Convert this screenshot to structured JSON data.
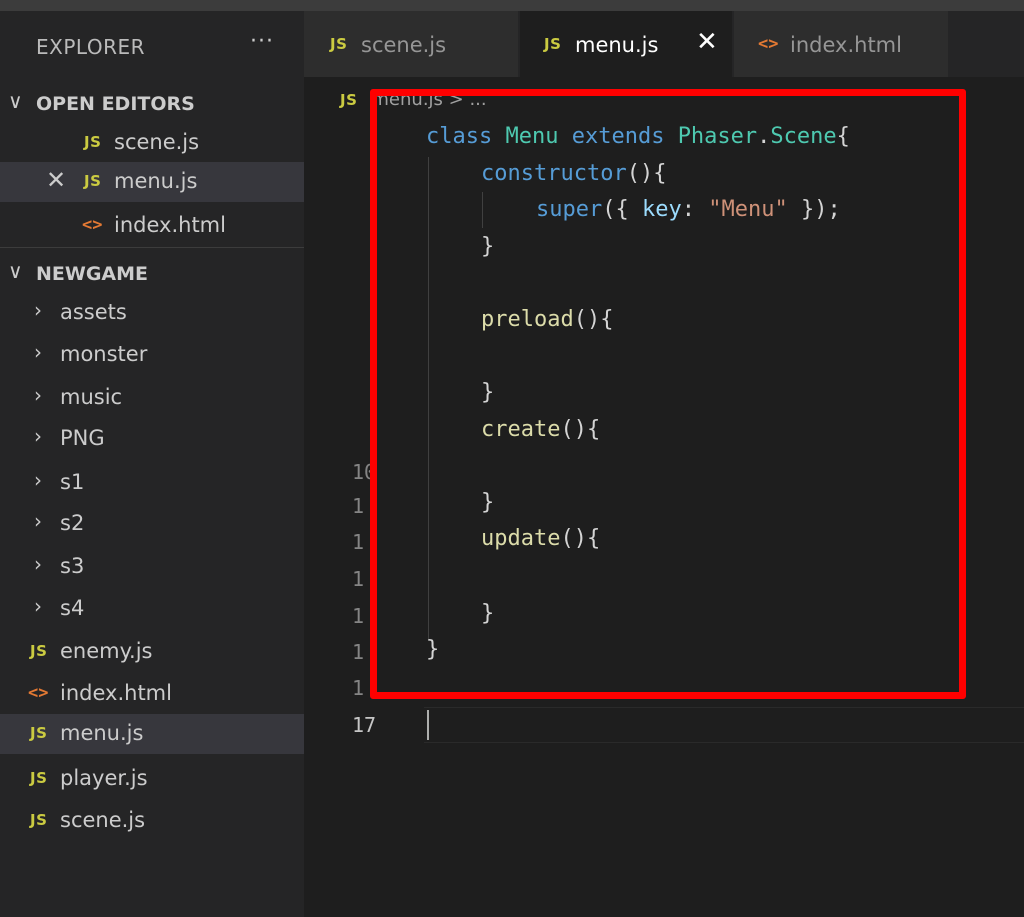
{
  "sidebar": {
    "title": "EXPLORER",
    "more": "···",
    "open_editors": {
      "header": "OPEN EDITORS",
      "items": [
        {
          "badge": "JS",
          "label": "scene.js"
        },
        {
          "badge": "JS",
          "label": "menu.js",
          "close": "✕"
        },
        {
          "badge": "<>",
          "label": "index.html"
        }
      ]
    },
    "project": {
      "header": "NEWGAME",
      "folders": [
        "assets",
        "monster",
        "music",
        "PNG",
        "s1",
        "s2",
        "s3",
        "s4"
      ],
      "files": [
        {
          "badge": "JS",
          "label": "enemy.js"
        },
        {
          "badge": "<>",
          "label": "index.html"
        },
        {
          "badge": "JS",
          "label": "menu.js"
        },
        {
          "badge": "JS",
          "label": "player.js"
        },
        {
          "badge": "JS",
          "label": "scene.js"
        }
      ]
    }
  },
  "tabs": [
    {
      "badge": "JS",
      "label": "scene.js"
    },
    {
      "badge": "JS",
      "label": "menu.js",
      "close": "✕"
    },
    {
      "badge": "<>",
      "label": "index.html"
    }
  ],
  "breadcrumb": {
    "badge": "JS",
    "text": "menu.js > ..."
  },
  "gutter": [
    "10",
    "1",
    "1",
    "1",
    "1",
    "1",
    "1",
    "17"
  ],
  "code": {
    "l1": {
      "k1": "class",
      "c1": "Menu",
      "k2": "extends",
      "c2": "Phaser",
      "p1": ".",
      "c3": "Scene",
      "p2": "{"
    },
    "l2": {
      "f": "constructor",
      "p": "(){"
    },
    "l3": {
      "f": "super",
      "p1": "({ ",
      "v": "key",
      "p2": ": ",
      "s": "\"Menu\"",
      "p3": " });"
    },
    "l4": "}",
    "l5": {
      "f": "preload",
      "p": "(){"
    },
    "l6": "}",
    "l7": {
      "f": "create",
      "p": "(){"
    },
    "l8": "}",
    "l9": {
      "f": "update",
      "p": "(){"
    },
    "l10": "}",
    "l11": "}"
  },
  "colors": {
    "highlight": "#ff0000",
    "js_badge": "#cbcb41",
    "html_icon": "#e37933"
  }
}
